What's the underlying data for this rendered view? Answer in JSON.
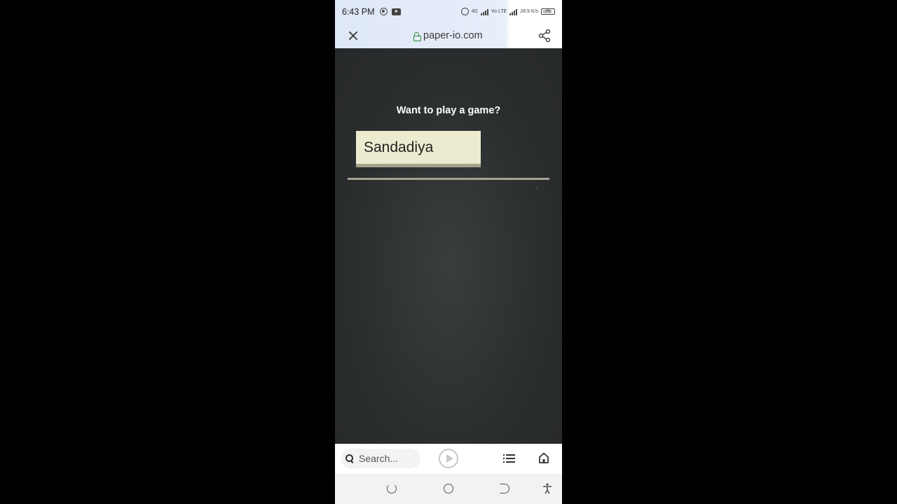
{
  "status_bar": {
    "time": "6:43 PM",
    "network_label": "4G",
    "volte_label": "Vo LTE",
    "speed": "28.9 K/s",
    "battery": "46"
  },
  "browser": {
    "url": "paper-io.com"
  },
  "game": {
    "prompt": "Want to play a game?",
    "player_name": "Sandadiya"
  },
  "bottom_bar": {
    "search_placeholder": "Search..."
  },
  "colors": {
    "game_background": "#2d3031",
    "input_background": "#ecebd0",
    "input_border": "#a5a48b",
    "lock_green": "#2e8b3c"
  }
}
